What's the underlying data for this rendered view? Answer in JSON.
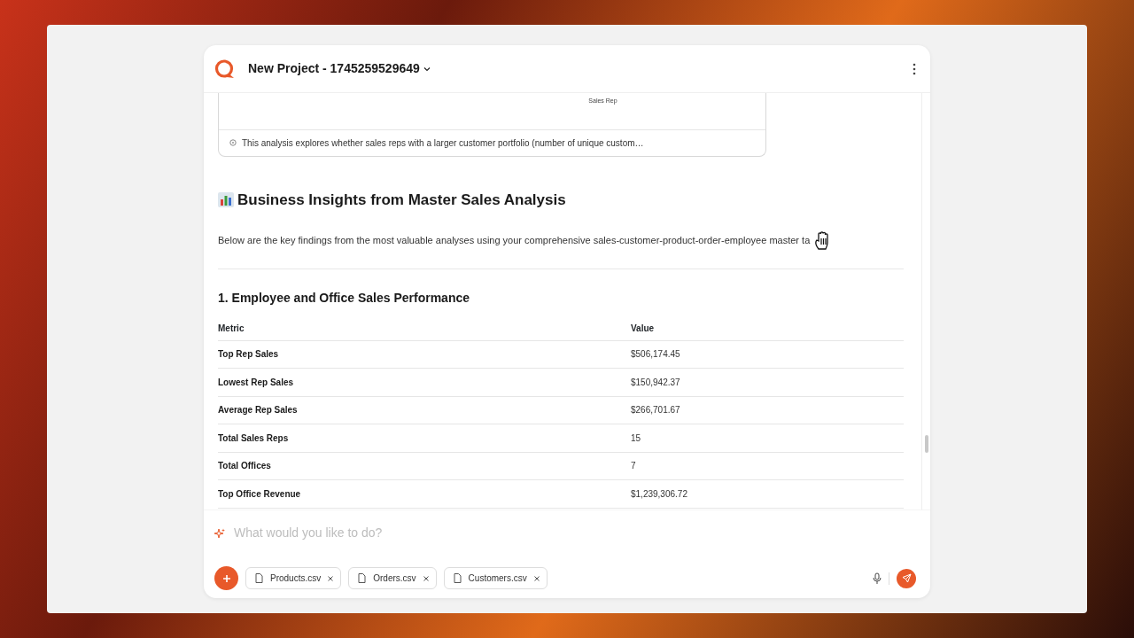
{
  "header": {
    "title": "New Project - 1745259529649"
  },
  "chart_card": {
    "axis_label": "Sales Rep",
    "caption": "This analysis explores whether sales reps with a larger customer portfolio (number of unique custom…"
  },
  "insights": {
    "title": "Business Insights from Master Sales Analysis",
    "intro": "Below are the key findings from the most valuable analyses using your comprehensive sales-customer-product-order-employee master ta"
  },
  "section": {
    "title": "1. Employee and Office Sales Performance",
    "columns": [
      "Metric",
      "Value"
    ],
    "rows": [
      [
        "Top Rep Sales",
        "$506,174.45"
      ],
      [
        "Lowest Rep Sales",
        "$150,942.37"
      ],
      [
        "Average Rep Sales",
        "$266,701.67"
      ],
      [
        "Total Sales Reps",
        "15"
      ],
      [
        "Total Offices",
        "7"
      ],
      [
        "Top Office Revenue",
        "$1,239,306.72"
      ]
    ]
  },
  "composer": {
    "placeholder": "What would you like to do?",
    "attachments": [
      "Products.csv",
      "Orders.csv",
      "Customers.csv"
    ]
  }
}
